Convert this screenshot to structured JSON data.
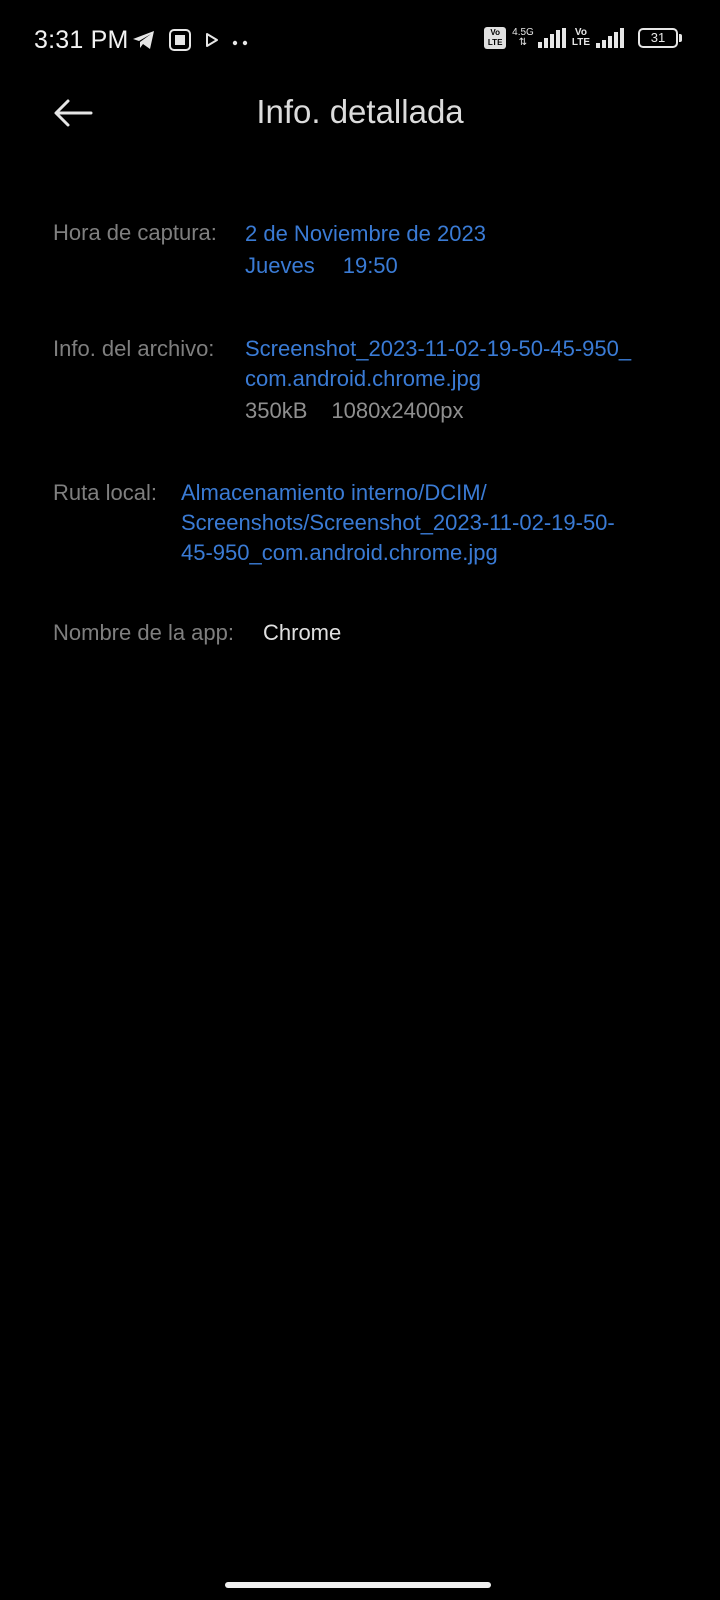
{
  "status_bar": {
    "time": "3:31 PM",
    "left_icons": [
      "telegram-icon",
      "square-app-icon",
      "play-icon",
      "more-dots-icon"
    ],
    "volte1_top": "Vo",
    "volte1_bottom": "LTE",
    "network_type": "4.5G",
    "volte2_top": "Vo",
    "volte2_bottom": "LTE",
    "battery_level": "31",
    "colors": {
      "text": "#f2f2f2"
    }
  },
  "header": {
    "back_icon": "arrow-left-icon",
    "title": "Info. detallada"
  },
  "details": {
    "capture": {
      "label": "Hora de captura:",
      "date": "2 de Noviembre de 2023",
      "weekday": "Jueves",
      "time": "19:50"
    },
    "file": {
      "label": "Info. del archivo:",
      "name_line1": "Screenshot_2023-11-02-19-50-45-950_",
      "name_line2": "com.android.chrome.jpg",
      "size": "350kB",
      "dimensions": "1080x2400px"
    },
    "path": {
      "label": "Ruta local:",
      "line1": "Almacenamiento interno/DCIM/",
      "line2": "Screenshots/Screenshot_2023-11-02-19-50-",
      "line3": "45-950_com.android.chrome.jpg"
    },
    "app": {
      "label": "Nombre de la app:",
      "value": "Chrome"
    }
  },
  "colors": {
    "background": "#000000",
    "label": "#7f7f7f",
    "link": "#3a7bd5",
    "value": "#e0e0e0"
  }
}
